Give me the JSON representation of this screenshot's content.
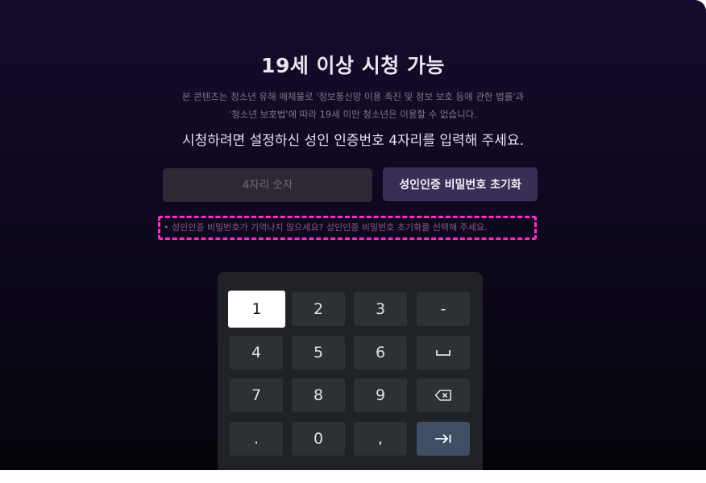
{
  "header": {
    "title": "19세 이상 시청 가능",
    "desc_line1": "본 콘텐츠는 청소년 유해 매체물로 '정보통신망 이용 촉진 및 정보 보호 등에 관한 법률'과",
    "desc_line2": "'청소년 보호법'에 따라 19세 미만 청소년은 이용할 수 없습니다.",
    "prompt": "시청하려면 설정하신 성인 인증번호 4자리를 입력해 주세요."
  },
  "pin": {
    "placeholder": "4자리 숫자",
    "value": ""
  },
  "reset_button": {
    "label": "성인인증 비밀번호 초기화"
  },
  "hint": "• 성인인증 비밀번호가 기억나지 않으세요? 성인인증 비밀번호 초기화를 선택해 주세요.",
  "keypad": {
    "active_key": "1",
    "keys": {
      "k1": "1",
      "k2": "2",
      "k3": "3",
      "dash": "-",
      "k4": "4",
      "k5": "5",
      "k6": "6",
      "k7": "7",
      "k8": "8",
      "k9": "9",
      "dot": ".",
      "k0": "0",
      "comma": ","
    },
    "icons": {
      "space": "space-icon",
      "backspace": "backspace-icon",
      "enter": "tab-enter-icon"
    }
  },
  "colors": {
    "highlight_border": "#ff2cc7",
    "reset_button_bg": "#3b2e54",
    "enter_key_bg": "#3e4f64"
  }
}
